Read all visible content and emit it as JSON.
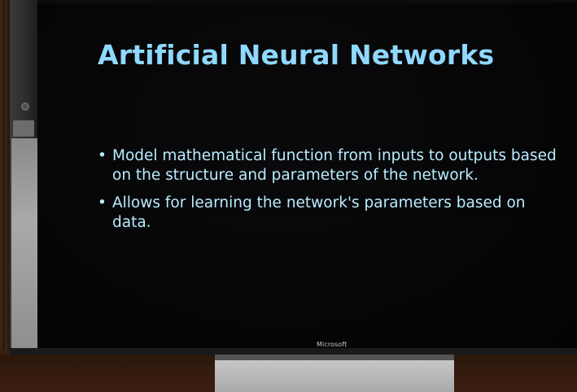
{
  "slide": {
    "title": "Artificial Neural Networks",
    "bullets": [
      "Model mathematical function from inputs to outputs based on the structure and parameters of the network.",
      "Allows for learning the network's parameters based on data."
    ],
    "bullet_glyph": "•"
  },
  "monitor": {
    "brand": "Microsoft"
  },
  "colors": {
    "title": "#8fd8ff",
    "body_text": "#b9ecff",
    "screen_background": "#050506"
  }
}
